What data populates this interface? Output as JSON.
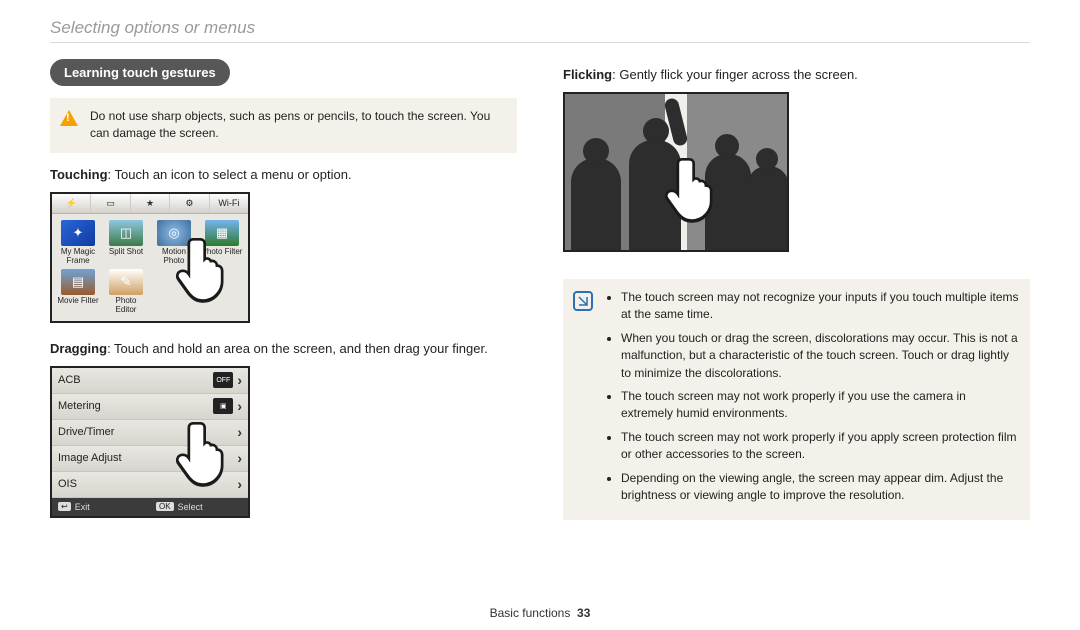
{
  "header": {
    "title": "Selecting options or menus"
  },
  "left": {
    "badge": "Learning touch gestures",
    "warning_text": "Do not use sharp objects, such as pens or pencils, to touch the screen. You can damage the screen.",
    "touching_label": "Touching",
    "touching_desc": ": Touch an icon to select a menu or option.",
    "dragging_label": "Dragging",
    "dragging_desc": ": Touch and hold an area on the screen, and then drag your finger.",
    "camera_tabs": {
      "wifi": "Wi-Fi"
    },
    "apps": [
      {
        "label": "My Magic Frame"
      },
      {
        "label": "Split Shot"
      },
      {
        "label": "Motion Photo"
      },
      {
        "label": "Photo Filter"
      },
      {
        "label": "Movie Filter"
      },
      {
        "label": "Photo Editor"
      }
    ],
    "settings_rows": [
      {
        "label": "ACB",
        "ind": "OFF"
      },
      {
        "label": "Metering",
        "ind": ""
      },
      {
        "label": "Drive/Timer",
        "ind": ""
      },
      {
        "label": "Image Adjust",
        "ind": ""
      },
      {
        "label": "OIS",
        "ind": ""
      }
    ],
    "footer": {
      "exit_key": "↩",
      "exit": "Exit",
      "ok_key": "OK",
      "select": "Select"
    }
  },
  "right": {
    "flicking_label": "Flicking",
    "flicking_desc": ": Gently flick your finger across the screen.",
    "notes": [
      "The touch screen may not recognize your inputs if you touch multiple items at the same time.",
      "When you touch or drag the screen, discolorations may occur. This is not a malfunction, but a characteristic of the touch screen. Touch or drag lightly to minimize the discolorations.",
      "The touch screen may not work properly if you use the camera in extremely humid environments.",
      "The touch screen may not work properly if you apply screen protection film or other accessories to the screen.",
      "Depending on the viewing angle, the screen may appear dim. Adjust the brightness or viewing angle to improve the resolution."
    ]
  },
  "footer": {
    "section": "Basic functions",
    "page": "33"
  }
}
